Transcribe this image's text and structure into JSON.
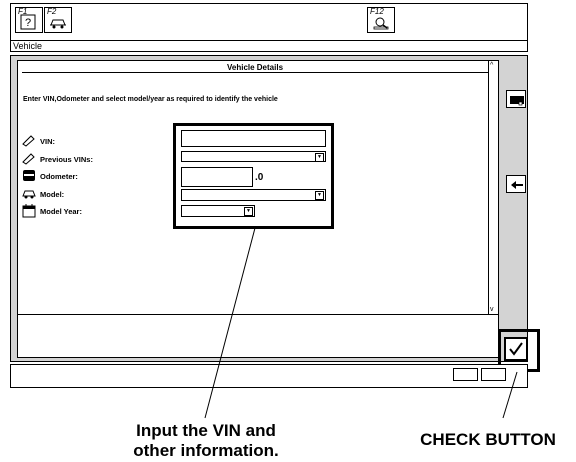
{
  "toolbar": {
    "f1_label": "F1",
    "f1_icon": "help-icon",
    "f2_label": "F2",
    "f2_icon": "car-icon",
    "f12_label": "F12",
    "f12_icon": "search-icon"
  },
  "breadcrumb": "Vehicle",
  "panel": {
    "title": "Vehicle Details",
    "instructions": "Enter VIN,Odometer and select model/year as required to identify the vehicle"
  },
  "fields": {
    "vin": {
      "label": "VIN:",
      "value": "",
      "icon": "vin-icon"
    },
    "previous_vins": {
      "label": "Previous VINs:",
      "value": "",
      "icon": "vin-icon"
    },
    "odometer": {
      "label": "Odometer:",
      "value": "",
      "suffix": ".0",
      "icon": "odometer-icon"
    },
    "model": {
      "label": "Model:",
      "value": "",
      "icon": "car-icon"
    },
    "model_year": {
      "label": "Model Year:",
      "value": "",
      "icon": "calendar-icon"
    }
  },
  "side_buttons": {
    "top_icon": "screen-icon",
    "back_icon": "left-arrow-icon",
    "check_icon": "checkmark-icon"
  },
  "callouts": {
    "input_note_line1": "Input the VIN and",
    "input_note_line2": "other information.",
    "check_note": "CHECK BUTTON"
  }
}
